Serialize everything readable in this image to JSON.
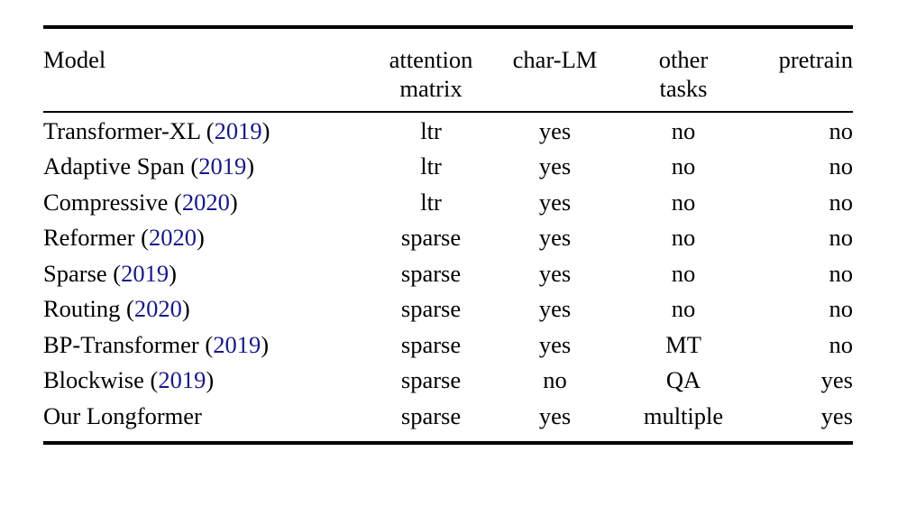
{
  "table": {
    "columns": [
      {
        "key": "model",
        "label_line1": "Model",
        "label_line2": "",
        "align": "left"
      },
      {
        "key": "attention",
        "label_line1": "attention",
        "label_line2": "matrix",
        "align": "center"
      },
      {
        "key": "charlm",
        "label_line1": "char-LM",
        "label_line2": "",
        "align": "center"
      },
      {
        "key": "other",
        "label_line1": "other",
        "label_line2": "tasks",
        "align": "center"
      },
      {
        "key": "pretrain",
        "label_line1": "pretrain",
        "label_line2": "",
        "align": "right"
      }
    ],
    "citation_color": "#181888",
    "rule_color": "#000000",
    "groups": [
      {
        "rows": [
          {
            "model_name": "Transformer-XL",
            "year": "2019",
            "model_full": "Transformer-XL (2019)",
            "attention": "ltr",
            "charlm": "yes",
            "other": "no",
            "pretrain": "no"
          },
          {
            "model_name": "Adaptive Span",
            "year": "2019",
            "model_full": "Adaptive Span (2019)",
            "attention": "ltr",
            "charlm": "yes",
            "other": "no",
            "pretrain": "no"
          },
          {
            "model_name": "Compressive",
            "year": "2020",
            "model_full": "Compressive (2020)",
            "attention": "ltr",
            "charlm": "yes",
            "other": "no",
            "pretrain": "no"
          }
        ]
      },
      {
        "rows": [
          {
            "model_name": "Reformer",
            "year": "2020",
            "model_full": "Reformer (2020)",
            "attention": "sparse",
            "charlm": "yes",
            "other": "no",
            "pretrain": "no"
          },
          {
            "model_name": "Sparse",
            "year": "2019",
            "model_full": "Sparse (2019)",
            "attention": "sparse",
            "charlm": "yes",
            "other": "no",
            "pretrain": "no"
          },
          {
            "model_name": "Routing",
            "year": "2020",
            "model_full": "Routing (2020)",
            "attention": "sparse",
            "charlm": "yes",
            "other": "no",
            "pretrain": "no"
          }
        ]
      },
      {
        "rows": [
          {
            "model_name": "BP-Transformer",
            "year": "2019",
            "model_full": "BP-Transformer (2019)",
            "attention": "sparse",
            "charlm": "yes",
            "other": "MT",
            "pretrain": "no"
          },
          {
            "model_name": "Blockwise",
            "year": "2019",
            "model_full": "Blockwise (2019)",
            "attention": "sparse",
            "charlm": "no",
            "other": "QA",
            "pretrain": "yes"
          }
        ]
      },
      {
        "rows": [
          {
            "model_name": "Our Longformer",
            "year": "",
            "model_full": "Our Longformer",
            "attention": "sparse",
            "charlm": "yes",
            "other": "multiple",
            "pretrain": "yes"
          }
        ]
      }
    ]
  }
}
